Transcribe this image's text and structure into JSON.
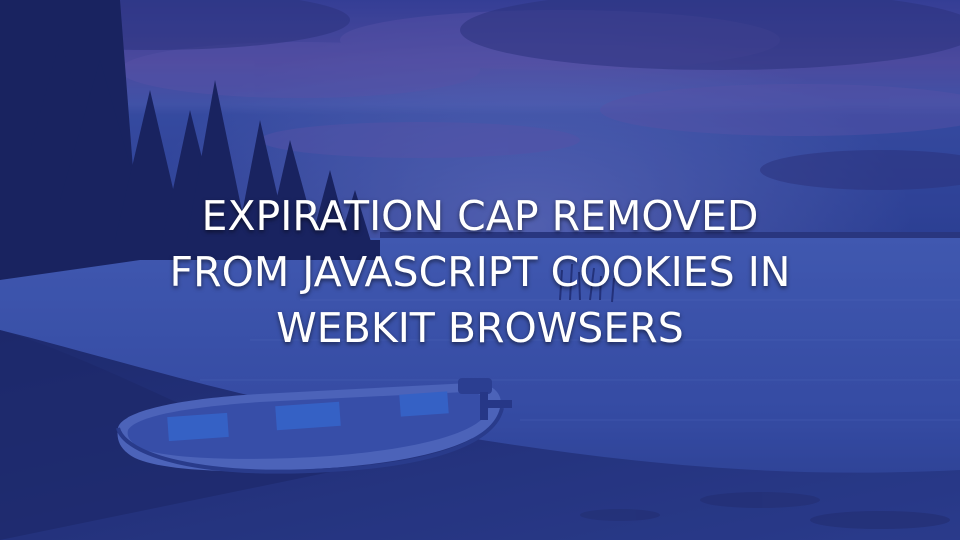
{
  "headline": {
    "lines": [
      "EXPIRATION CAP REMOVED",
      "FROM JAVASCRIPT COOKIES IN",
      "WEBKIT BROWSERS"
    ]
  },
  "background": {
    "description_icon": "lake-boat-photo",
    "tint": "#2b3fa8"
  }
}
